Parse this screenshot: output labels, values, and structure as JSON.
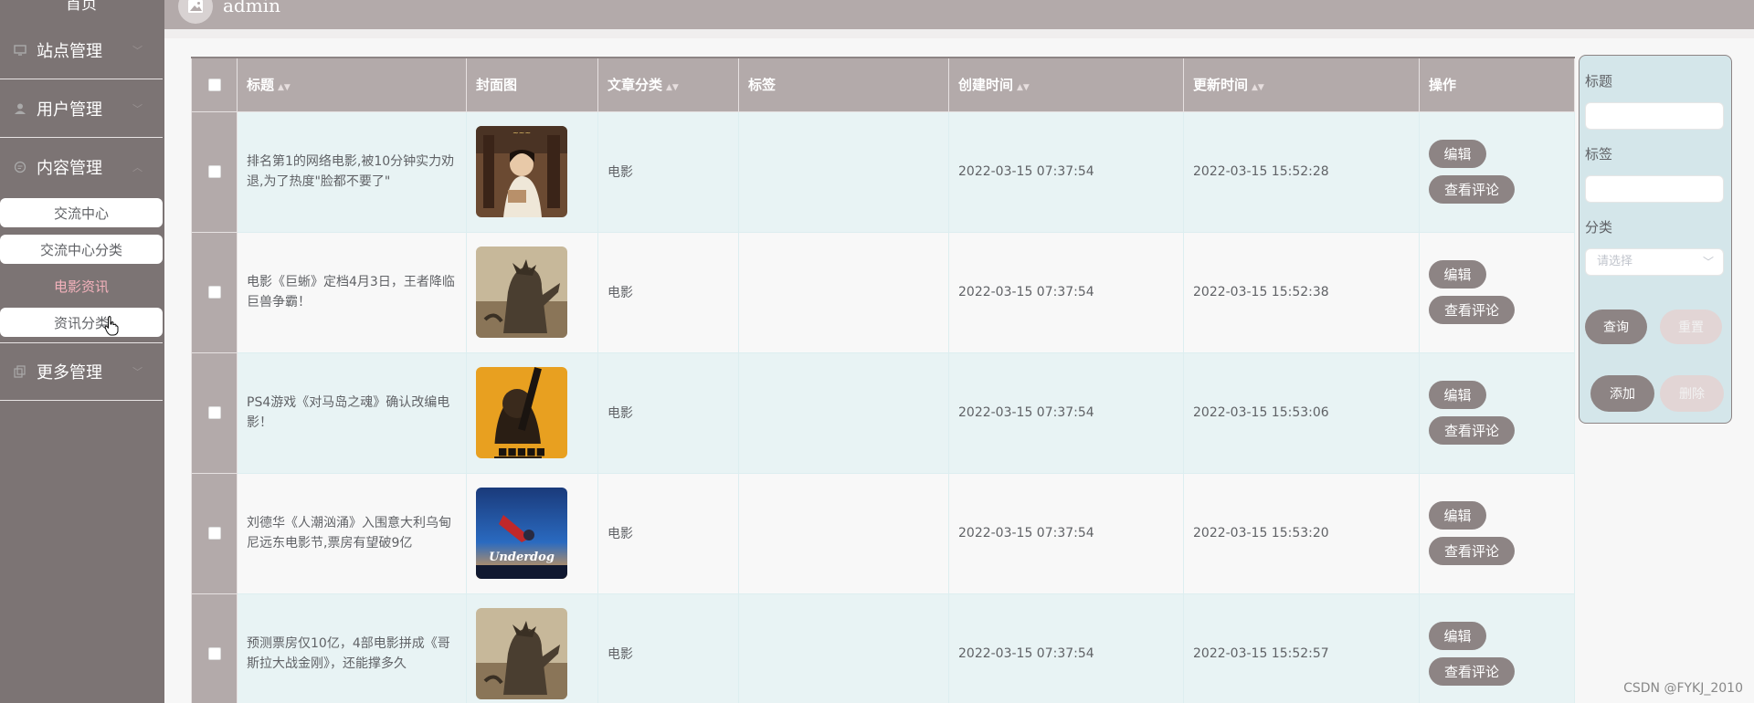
{
  "header": {
    "username": "admin"
  },
  "sidebar": {
    "home": "首页",
    "groups": [
      {
        "label": "站点管理",
        "icon": "monitor-icon"
      },
      {
        "label": "用户管理",
        "icon": "user-icon"
      },
      {
        "label": "内容管理",
        "icon": "chat-icon"
      },
      {
        "label": "更多管理",
        "icon": "copy-icon"
      }
    ],
    "sub_items": [
      "交流中心",
      "交流中心分类",
      "电影资讯",
      "资讯分类"
    ]
  },
  "table": {
    "columns": [
      "标题",
      "封面图",
      "文章分类",
      "标签",
      "创建时间",
      "更新时间",
      "操作"
    ],
    "edit_label": "编辑",
    "comments_label": "查看评论",
    "rows": [
      {
        "title": "排名第1的网络电影,被10分钟实力劝退,为了热度\"脸都不要了\"",
        "category": "电影",
        "tag": "",
        "created": "2022-03-15 07:37:54",
        "updated": "2022-03-15 15:52:28",
        "cover": "poster-costume-drama"
      },
      {
        "title": "电影《巨蜥》定档4月3日，王者降临巨兽争霸！",
        "category": "电影",
        "tag": "",
        "created": "2022-03-15 07:37:54",
        "updated": "2022-03-15 15:52:38",
        "cover": "poster-monster"
      },
      {
        "title": "PS4游戏《对马岛之魂》确认改编电影！",
        "category": "电影",
        "tag": "",
        "created": "2022-03-15 07:37:54",
        "updated": "2022-03-15 15:53:06",
        "cover": "poster-yellow-soldier"
      },
      {
        "title": "刘德华《人潮汹涌》入围意大利乌甸尼远东电影节,票房有望破9亿",
        "category": "电影",
        "tag": "",
        "created": "2022-03-15 07:37:54",
        "updated": "2022-03-15 15:53:20",
        "cover": "poster-underdog"
      },
      {
        "title": "预测票房仅10亿，4部电影拼成《哥斯拉大战金刚》，还能撑多久",
        "category": "电影",
        "tag": "",
        "created": "2022-03-15 07:37:54",
        "updated": "2022-03-15 15:52:57",
        "cover": "poster-monster"
      }
    ]
  },
  "filter": {
    "title_label": "标题",
    "tag_label": "标签",
    "category_label": "分类",
    "category_placeholder": "请选择",
    "search": "查询",
    "reset": "重置",
    "add": "添加",
    "delete": "删除"
  },
  "watermark": "CSDN @FYKJ_2010"
}
